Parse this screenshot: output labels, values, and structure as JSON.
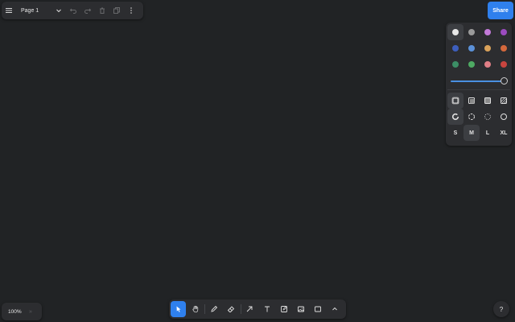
{
  "menu": {
    "page_name": "Page 1"
  },
  "share": {
    "label": "Share"
  },
  "style_panel": {
    "colors": [
      {
        "name": "white",
        "hex": "#e8e8e8",
        "selected": true
      },
      {
        "name": "grey",
        "hex": "#9a9a9a"
      },
      {
        "name": "light-violet",
        "hex": "#c27ad8"
      },
      {
        "name": "violet",
        "hex": "#9b4bbf"
      },
      {
        "name": "blue",
        "hex": "#3d5ebd"
      },
      {
        "name": "light-blue",
        "hex": "#5b91d8"
      },
      {
        "name": "yellow",
        "hex": "#d9a25a"
      },
      {
        "name": "orange",
        "hex": "#d4683c"
      },
      {
        "name": "green",
        "hex": "#3c8e66"
      },
      {
        "name": "light-green",
        "hex": "#4eaa63"
      },
      {
        "name": "light-red",
        "hex": "#e07f86"
      },
      {
        "name": "red",
        "hex": "#c9453f"
      }
    ],
    "opacity": 1,
    "sizes": [
      "S",
      "M",
      "L",
      "XL"
    ],
    "selected_size": "M"
  },
  "zoom": {
    "level": "100%"
  },
  "help": {
    "label": "?"
  },
  "colors": {
    "accent": "#2f80ed",
    "canvas": "#212325",
    "panel": "#2c2d30"
  }
}
